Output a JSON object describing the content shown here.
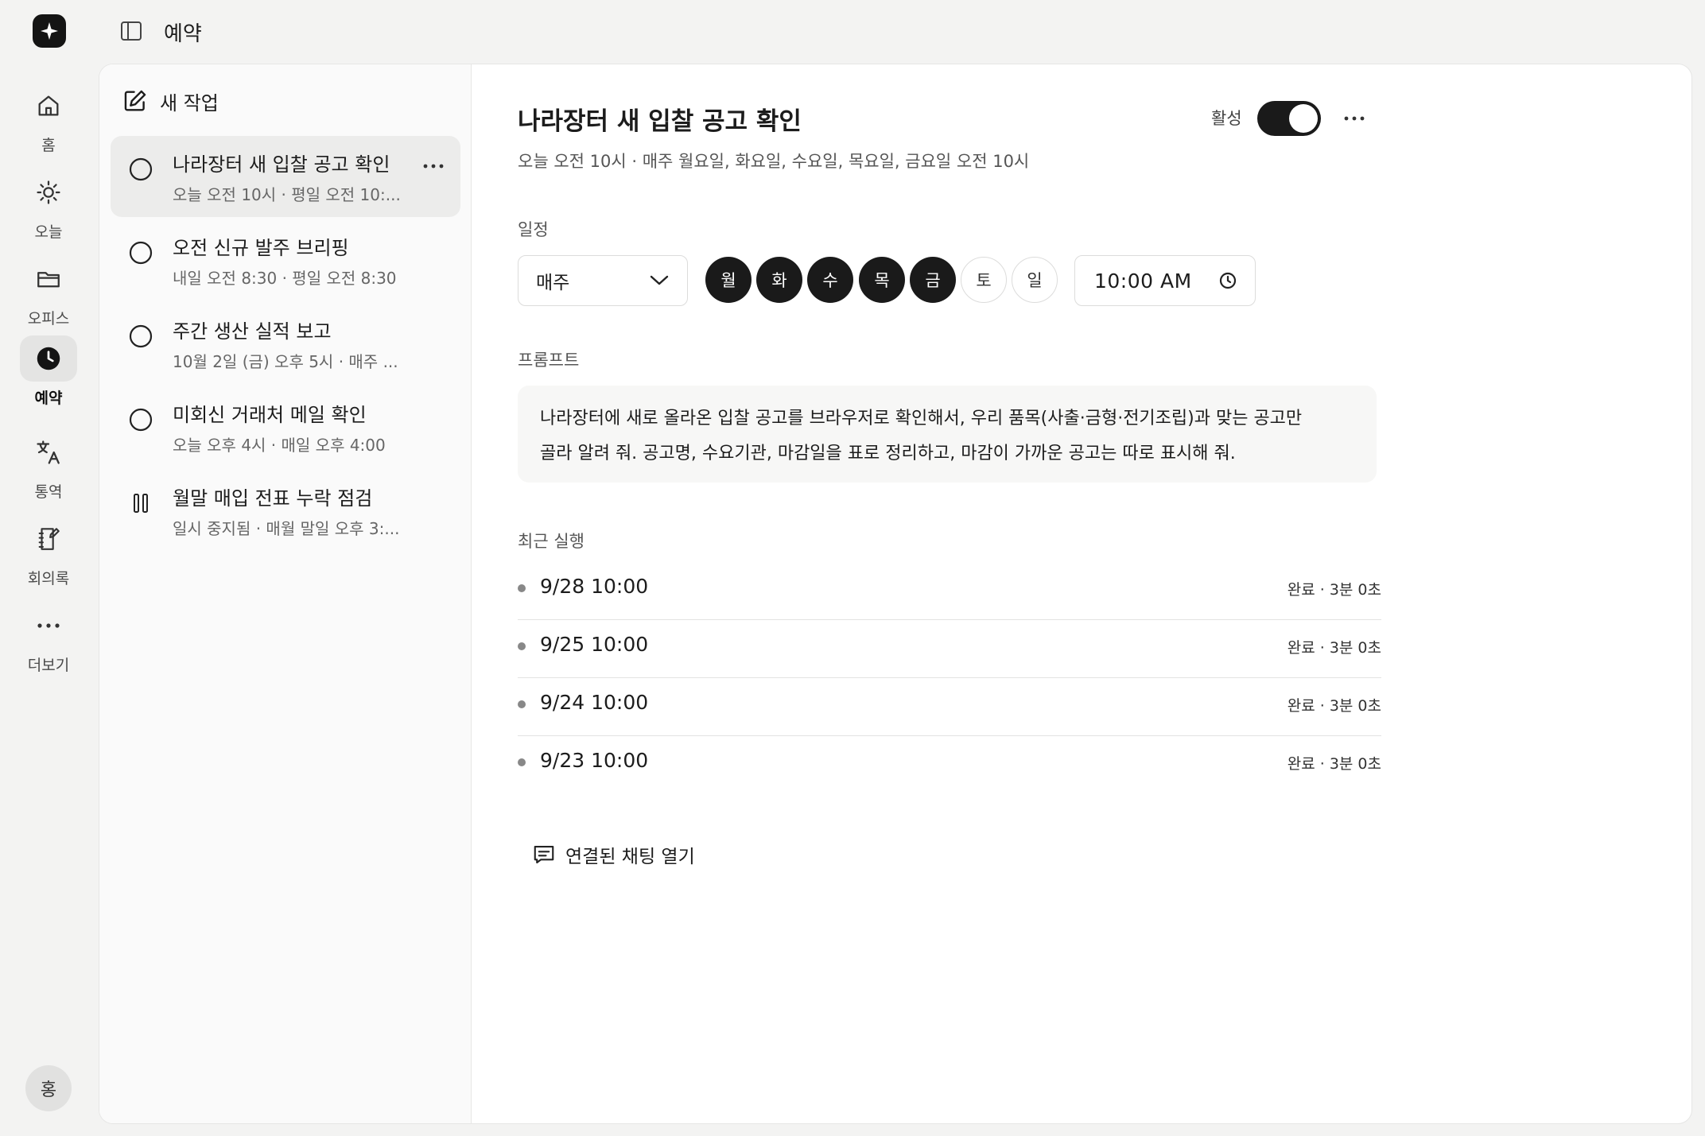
{
  "topbar": {
    "title": "예약",
    "sidebar_toggle_icon": "sidebar-toggle-icon"
  },
  "rail": {
    "items": [
      {
        "label": "홈",
        "icon": "home-icon"
      },
      {
        "label": "오늘",
        "icon": "sun-icon"
      },
      {
        "label": "오피스",
        "icon": "folder-icon"
      },
      {
        "label": "예약",
        "icon": "clock-icon",
        "active": true
      },
      {
        "label": "통역",
        "icon": "translate-icon"
      },
      {
        "label": "회의록",
        "icon": "notebook-icon"
      },
      {
        "label": "더보기",
        "icon": "more-icon"
      }
    ],
    "avatar": "홍"
  },
  "list": {
    "new_task": "새 작업",
    "tasks": [
      {
        "title": "나라장터 새 입찰 공고 확인",
        "sub": "오늘 오전 10시 · 평일 오전 10:...",
        "status": "circle",
        "selected": true
      },
      {
        "title": "오전 신규 발주 브리핑",
        "sub": "내일 오전 8:30 · 평일 오전 8:30",
        "status": "circle"
      },
      {
        "title": "주간 생산 실적 보고",
        "sub": "10월 2일 (금) 오후 5시 · 매주 ...",
        "status": "circle"
      },
      {
        "title": "미회신 거래처 메일 확인",
        "sub": "오늘 오후 4시 · 매일 오후 4:00",
        "status": "circle"
      },
      {
        "title": "월말 매입 전표 누락 점검",
        "sub": "일시 중지됨 · 매월 말일 오후 3:...",
        "status": "paused"
      }
    ]
  },
  "detail": {
    "title": "나라장터 새 입찰 공고 확인",
    "subtitle": "오늘 오전 10시 · 매주 월요일, 화요일, 수요일, 목요일, 금요일 오전 10시",
    "active_label": "활성",
    "active": true,
    "schedule_label": "일정",
    "frequency": "매주",
    "days": [
      {
        "label": "월",
        "on": true
      },
      {
        "label": "화",
        "on": true
      },
      {
        "label": "수",
        "on": true
      },
      {
        "label": "목",
        "on": true
      },
      {
        "label": "금",
        "on": true
      },
      {
        "label": "토",
        "on": false
      },
      {
        "label": "일",
        "on": false
      }
    ],
    "time": "10:00 AM",
    "prompt_label": "프롬프트",
    "prompt_line1": "나라장터에 새로 올라온 입찰 공고를 브라우저로 확인해서, 우리 품목(사출·금형·전기조립)과 맞는 공고만",
    "prompt_line2": "골라 알려 줘. 공고명, 수요기관, 마감일을 표로 정리하고, 마감이 가까운 공고는 따로 표시해 줘.",
    "runs_label": "최근 실행",
    "runs": [
      {
        "time": "9/28 10:00",
        "status": "완료 · 3분 0초"
      },
      {
        "time": "9/25 10:00",
        "status": "완료 · 3분 0초"
      },
      {
        "time": "9/24 10:00",
        "status": "완료 · 3분 0초"
      },
      {
        "time": "9/23 10:00",
        "status": "완료 · 3분 0초"
      }
    ],
    "open_chat": "연결된 채팅 열기"
  },
  "colors": {
    "accent": "#1a1a1a",
    "background": "#f3f3f2",
    "card": "#ffffff",
    "selected": "#ececeb"
  }
}
